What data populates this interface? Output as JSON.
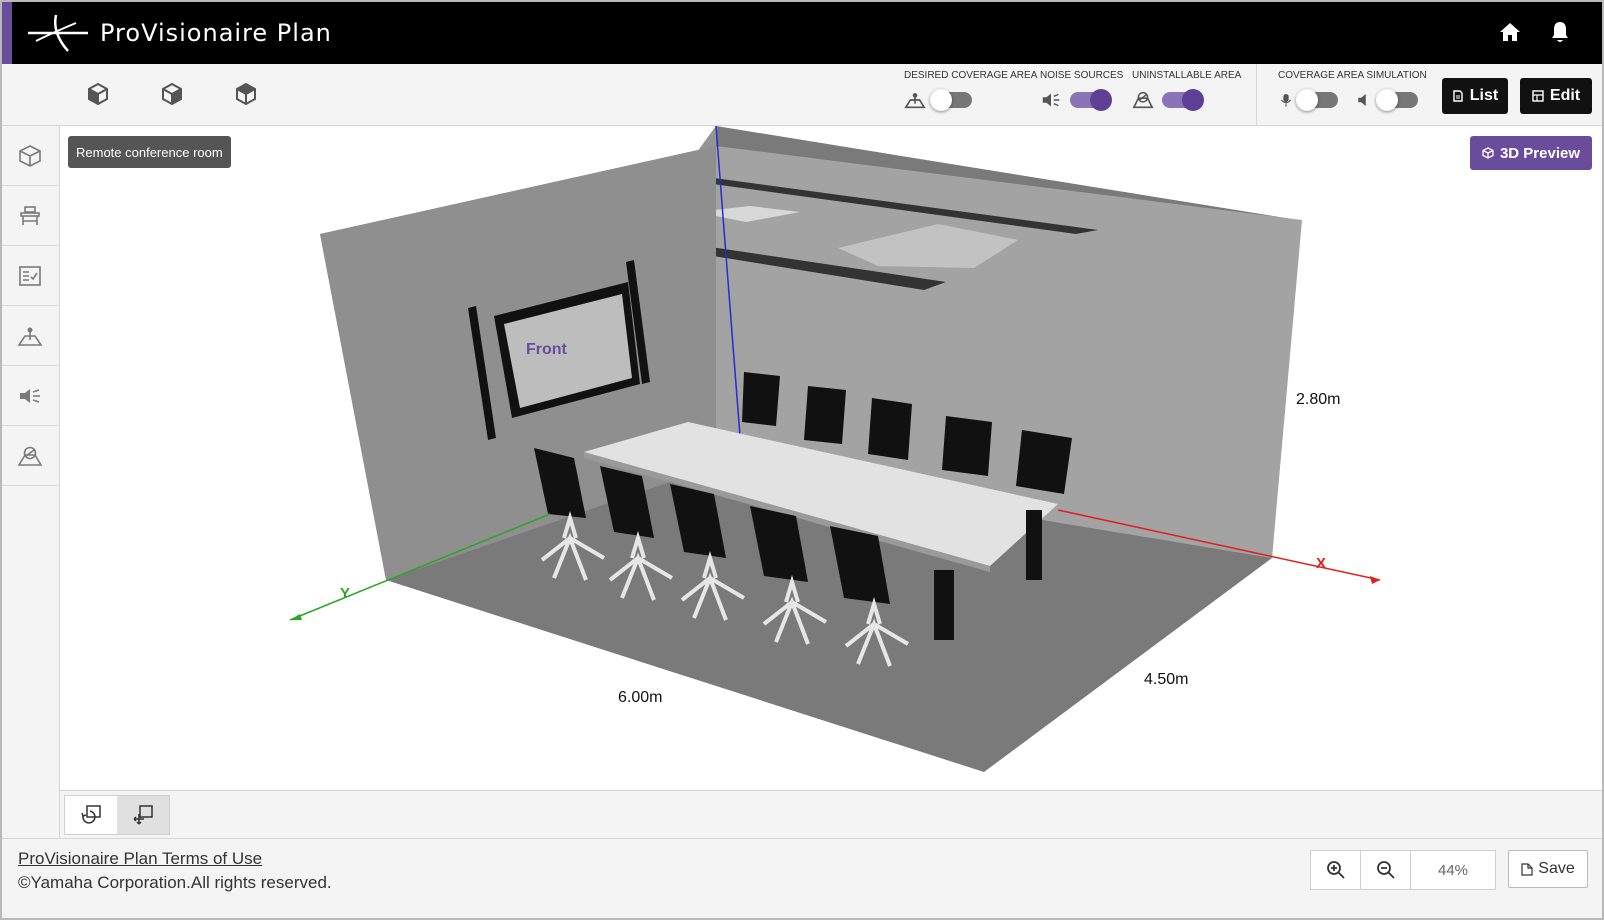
{
  "app": {
    "title": "ProVisionaire Plan"
  },
  "header": {
    "home_icon": "home-icon",
    "notification_icon": "bell-icon"
  },
  "toolbar": {
    "view_buttons": [
      "cube-view-icon",
      "cube-view-icon",
      "cube-view-icon"
    ],
    "toggles": [
      {
        "label": "DESIRED COVERAGE AREA",
        "icon": "coverage-area-icon",
        "on": false
      },
      {
        "label": "NOISE SOURCES",
        "icon": "noise-source-icon",
        "on": true
      },
      {
        "label": "UNINSTALLABLE AREA",
        "icon": "uninstallable-area-icon",
        "on": true
      }
    ],
    "simulation": {
      "label": "COVERAGE AREA SIMULATION",
      "mic_on": false,
      "speaker_on": false
    },
    "list_label": "List",
    "edit_label": "Edit"
  },
  "sidebar": {
    "items": [
      "room-icon",
      "furniture-icon",
      "checklist-icon",
      "coverage-area-icon",
      "noise-source-icon",
      "uninstallable-area-icon"
    ]
  },
  "viewport": {
    "room_name": "Remote conference room",
    "preview_label": "3D Preview",
    "screen_label": "Front",
    "dimensions": {
      "width": "6.00m",
      "depth": "4.50m",
      "height": "2.80m"
    },
    "axes": {
      "x": "X",
      "y": "Y"
    }
  },
  "bottom_tools": [
    "rotate-view-icon",
    "pan-view-icon"
  ],
  "footer": {
    "terms": "ProVisionaire Plan Terms of Use",
    "copyright": "©Yamaha Corporation.All rights reserved.",
    "zoom": "44%",
    "save_label": "Save"
  },
  "colors": {
    "accent": "#6a4c9c",
    "x_axis": "#e02020",
    "y_axis": "#2aa52a",
    "z_axis": "#2030d0"
  }
}
